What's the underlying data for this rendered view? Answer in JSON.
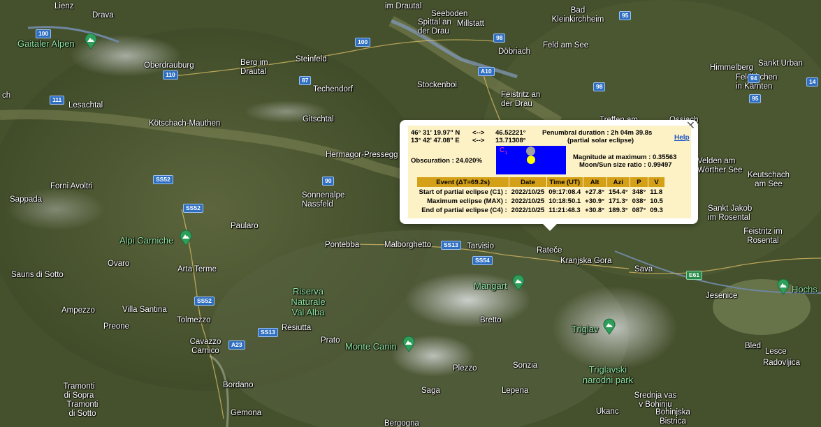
{
  "map": {
    "places": [
      {
        "text": "Lienz"
      },
      {
        "text": "Drava"
      },
      {
        "text": "im Drautal"
      },
      {
        "text": "Seeboden"
      },
      {
        "text": "Spittal an\nder Drau"
      },
      {
        "text": "Millstatt"
      },
      {
        "text": "Bad\nKleinkirchheim"
      },
      {
        "text": "Oberdrauburg"
      },
      {
        "text": "Berg im\nDrautal"
      },
      {
        "text": "Steinfeld"
      },
      {
        "text": "Döbriach"
      },
      {
        "text": "Feld am See"
      },
      {
        "text": "Himmelberg"
      },
      {
        "text": "Sankt Urban"
      },
      {
        "text": "Feldkirchen\nin Kärnten"
      },
      {
        "text": "Techendorf"
      },
      {
        "text": "Stockenboi"
      },
      {
        "text": "Feistritz an\nder Drau"
      },
      {
        "text": "Lesachtal"
      },
      {
        "text": "Kötschach-Mauthen"
      },
      {
        "text": "Gitschtal"
      },
      {
        "text": "Treffen am"
      },
      {
        "text": "Ossiach"
      },
      {
        "text": "Hermagor-Pressegg"
      },
      {
        "text": "Velden am\nWörther See"
      },
      {
        "text": "Keutschach\nam See"
      },
      {
        "text": "Forni Avoltri"
      },
      {
        "text": "Sappada"
      },
      {
        "text": "Sonnenalpe\nNassfeld"
      },
      {
        "text": "Sankt Jakob\nim Rosental"
      },
      {
        "text": "Feistritz im\nRosental"
      },
      {
        "text": "Paularo"
      },
      {
        "text": "Pontebba"
      },
      {
        "text": "Malborghetto"
      },
      {
        "text": "Tarvisio"
      },
      {
        "text": "Rateče"
      },
      {
        "text": "Kranjska Gora"
      },
      {
        "text": "Sava"
      },
      {
        "text": "Ovaro"
      },
      {
        "text": "Arta Terme"
      },
      {
        "text": "Sauris di Sotto"
      },
      {
        "text": "Jesenice"
      },
      {
        "text": "Ampezzo"
      },
      {
        "text": "Villa Santina"
      },
      {
        "text": "Bretto"
      },
      {
        "text": "Preone"
      },
      {
        "text": "Tolmezzo"
      },
      {
        "text": "Resiutta"
      },
      {
        "text": "Prato"
      },
      {
        "text": "Cavazzo\nCarnico"
      },
      {
        "text": "Bled"
      },
      {
        "text": "Lesce"
      },
      {
        "text": "Radovljica"
      },
      {
        "text": "Plezzo"
      },
      {
        "text": "Sonzia"
      },
      {
        "text": "Tramonti\ndi Sopra"
      },
      {
        "text": "Tramonti\ndi Sotto"
      },
      {
        "text": "Bordano"
      },
      {
        "text": "Saga"
      },
      {
        "text": "Lepena"
      },
      {
        "text": "Gemona"
      },
      {
        "text": "Ukanc"
      },
      {
        "text": "Srednja vas\nv Bohinju"
      },
      {
        "text": "Bohinjska\nBistrica"
      },
      {
        "text": "Bergogna"
      },
      {
        "text": "ch"
      }
    ],
    "parks": [
      {
        "text": "Gaitaler Alpen"
      },
      {
        "text": "Alpi Carniche"
      },
      {
        "text": "Riserva\nNaturale\nVal Alba"
      },
      {
        "text": "Mangart"
      },
      {
        "text": "Monte Canin"
      },
      {
        "text": "Triglav"
      },
      {
        "text": "Triglavski\nnarodni park"
      },
      {
        "text": "Hochs"
      }
    ],
    "shields": [
      {
        "text": "100"
      },
      {
        "text": "100"
      },
      {
        "text": "110"
      },
      {
        "text": "111"
      },
      {
        "text": "87"
      },
      {
        "text": "98"
      },
      {
        "text": "95"
      },
      {
        "text": "98"
      },
      {
        "text": "A10"
      },
      {
        "text": "94"
      },
      {
        "text": "95"
      },
      {
        "text": "14"
      },
      {
        "text": "90"
      },
      {
        "text": "SS52"
      },
      {
        "text": "SS52"
      },
      {
        "text": "SS13"
      },
      {
        "text": "SS54"
      },
      {
        "text": "SS52"
      },
      {
        "text": "SS13"
      },
      {
        "text": "A23"
      },
      {
        "text": "E61"
      }
    ]
  },
  "popup": {
    "lat_dms": "46° 31' 19.97\" N",
    "lon_dms": "13° 42' 47.08\" E",
    "arrow": "<-->",
    "lat_dec": "46.52221°",
    "lon_dec": "13.71308°",
    "penumbral": "Penumbral duration : 2h 04m 39.8s",
    "penumbral_note": "(partial solar eclipse)",
    "help": "Help",
    "obscuration": "Obscuration : 24.020%",
    "contact_label": "C",
    "contact_sub": "1",
    "magnitude": "Magnitude at maximum : 0.35563",
    "ratio": "Moon/Sun size ratio : 0.99497",
    "columns": [
      "Event (ΔT=69.2s)",
      "Date",
      "Time (UT)",
      "Alt",
      "Azi",
      "P",
      "V"
    ],
    "rows": [
      [
        "Start of partial eclipse (C1) :",
        "2022/10/25",
        "09:17:08.4",
        "+27.8°",
        "154.4°",
        "348°",
        "11.8"
      ],
      [
        "Maximum eclipse (MAX) :",
        "2022/10/25",
        "10:18:50.1",
        "+30.9°",
        "171.3°",
        "038°",
        "10.5"
      ],
      [
        "End of partial eclipse (C4) :",
        "2022/10/25",
        "11:21:48.3",
        "+30.8°",
        "189.3°",
        "087°",
        "09.3"
      ]
    ],
    "colors": {
      "panel": "#fdf1c6",
      "header": "#d4a017",
      "sky": "#0000ff",
      "sun": "#ffff00",
      "moon": "#a0a0a0",
      "contact": "#ff3ab0",
      "link": "#1a56c4"
    }
  }
}
